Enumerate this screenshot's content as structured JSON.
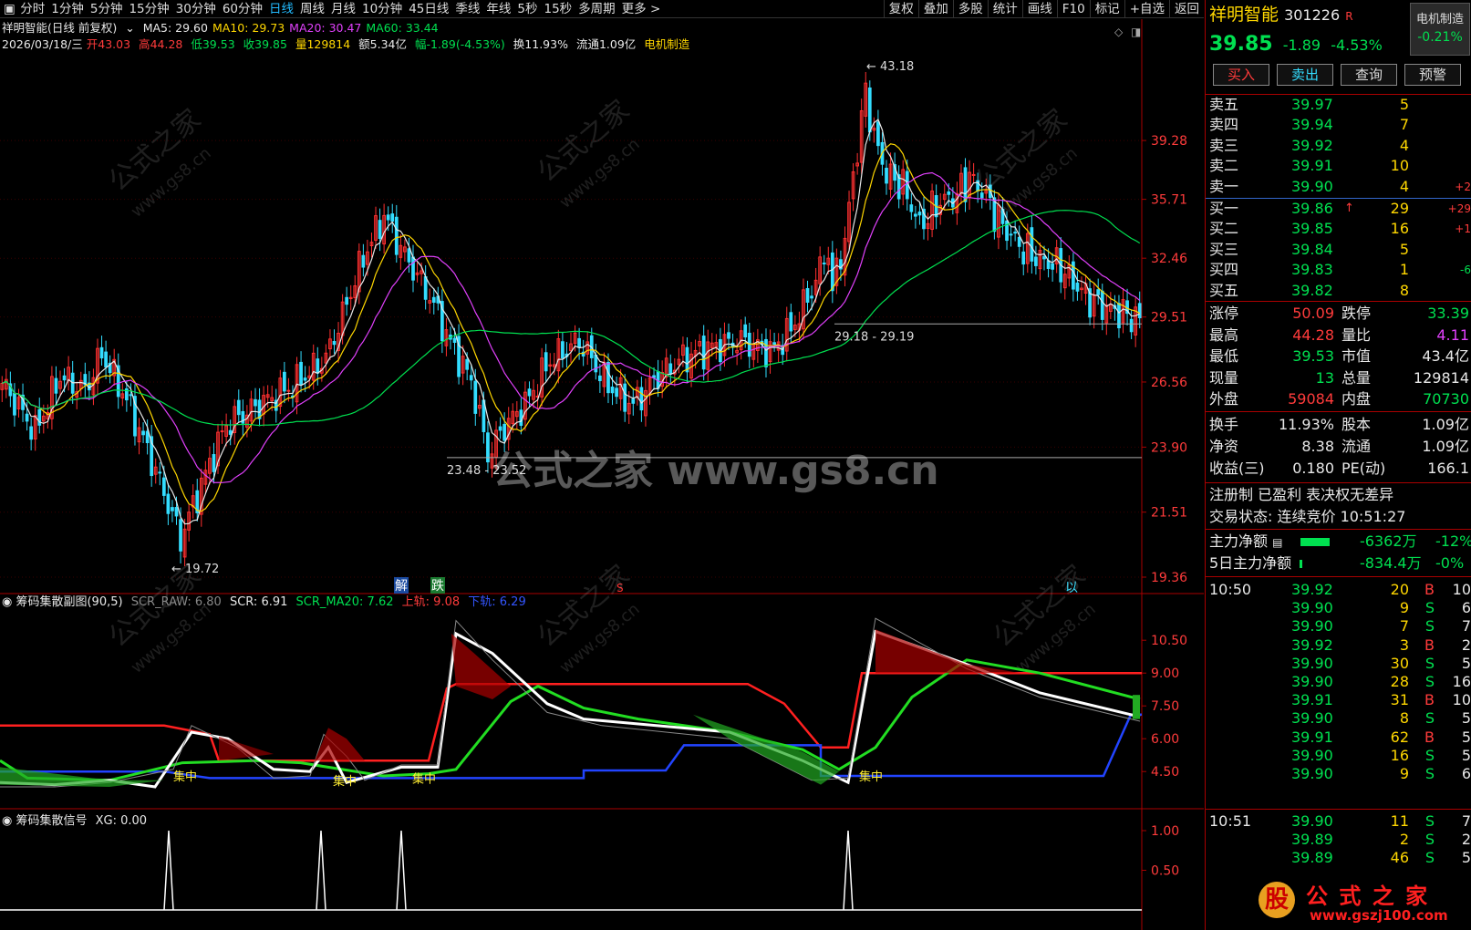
{
  "toolbar": {
    "periods": [
      "分时",
      "1分钟",
      "5分钟",
      "15分钟",
      "30分钟",
      "60分钟",
      "日线",
      "周线",
      "月线",
      "10分钟",
      "45日线",
      "季线",
      "年线",
      "5秒",
      "15秒",
      "多周期",
      "更多 >"
    ],
    "active_period": "日线",
    "tools": [
      "复权",
      "叠加",
      "多股",
      "统计",
      "画线",
      "F10",
      "标记",
      "+自选",
      "返回"
    ]
  },
  "main_chart": {
    "title": "祥明智能(日线 前复权)",
    "ma": [
      {
        "label": "MA5: 29.60",
        "color": "#e8e8e8"
      },
      {
        "label": "MA10: 29.73",
        "color": "#ffd700"
      },
      {
        "label": "MA20: 30.47",
        "color": "#e040fb"
      },
      {
        "label": "MA60: 33.44",
        "color": "#00e050"
      }
    ],
    "date": "2026/03/18/三",
    "open_label": "开",
    "open": "43.03",
    "high_label": "高",
    "high": "44.28",
    "low_label": "低",
    "low": "39.53",
    "close_label": "收",
    "close": "39.85",
    "vol_label": "量",
    "vol": "129814",
    "amount": "额5.34亿",
    "change": "幅-1.89(-4.53%)",
    "turnover": "换11.93%",
    "float": "流通1.09亿",
    "industry": "电机制造",
    "markers": {
      "jie": "解",
      "die": "跌",
      "s": "S",
      "ju": "以"
    },
    "annotations": {
      "peak": "43.18",
      "low_left": "19.72",
      "range1": "23.48 - 23.52",
      "range2": "29.18 - 29.19"
    },
    "watermark": "公式之家 www.gs8.cn",
    "watermark_small": "公式之家",
    "watermark_url": "www.gs8.cn"
  },
  "sub1": {
    "title": "筹码集散副图(90,5)",
    "scr_raw": "SCR_RAW: 6.80",
    "scr": "SCR: 6.91",
    "scr_ma20": "SCR_MA20: 7.62",
    "upper": "上轨: 9.08",
    "lower": "下轨: 6.29",
    "tag": "集中"
  },
  "sub2": {
    "title": "筹码集散信号",
    "xg": "XG: 0.00"
  },
  "price_axis": [
    "39.28",
    "35.71",
    "32.46",
    "29.51",
    "26.56",
    "23.90",
    "21.51",
    "19.36"
  ],
  "sub1_axis": [
    "10.50",
    "9.00",
    "7.50",
    "6.00",
    "4.50"
  ],
  "sub2_axis": [
    "1.00",
    "0.50"
  ],
  "chart_data": {
    "type": "candlestick",
    "y_range": [
      19.36,
      44.28
    ],
    "ma_series": [
      "MA5",
      "MA10",
      "MA20",
      "MA60"
    ]
  },
  "quote": {
    "name": "祥明智能",
    "code": "301226",
    "flag": "R",
    "industry_btn": "电机制造",
    "industry_change": "-0.21%",
    "price": "39.85",
    "change": "-1.89",
    "pct": "-4.53%",
    "buttons": [
      "买入",
      "卖出",
      "查询",
      "预警"
    ],
    "asks": [
      {
        "label": "卖五",
        "price": "39.97",
        "vol": "5",
        "extra": ""
      },
      {
        "label": "卖四",
        "price": "39.94",
        "vol": "7",
        "extra": ""
      },
      {
        "label": "卖三",
        "price": "39.92",
        "vol": "4",
        "extra": ""
      },
      {
        "label": "卖二",
        "price": "39.91",
        "vol": "10",
        "extra": ""
      },
      {
        "label": "卖一",
        "price": "39.90",
        "vol": "4",
        "extra": "+2"
      }
    ],
    "bids": [
      {
        "label": "买一",
        "price": "39.86",
        "vol": "29",
        "extra": "+29"
      },
      {
        "label": "买二",
        "price": "39.85",
        "vol": "16",
        "extra": "+1"
      },
      {
        "label": "买三",
        "price": "39.84",
        "vol": "5",
        "extra": ""
      },
      {
        "label": "买四",
        "price": "39.83",
        "vol": "1",
        "extra": "-6"
      },
      {
        "label": "买五",
        "price": "39.82",
        "vol": "8",
        "extra": ""
      }
    ],
    "stats": [
      {
        "l1": "涨停",
        "v1": "50.09",
        "c1": "red",
        "l2": "跌停",
        "v2": "33.39",
        "c2": "green"
      },
      {
        "l1": "最高",
        "v1": "44.28",
        "c1": "red",
        "l2": "量比",
        "v2": "4.11",
        "c2": "magenta"
      },
      {
        "l1": "最低",
        "v1": "39.53",
        "c1": "green",
        "l2": "市值",
        "v2": "43.4亿",
        "c2": "white"
      },
      {
        "l1": "现量",
        "v1": "13",
        "c1": "green",
        "l2": "总量",
        "v2": "129814",
        "c2": "white"
      },
      {
        "l1": "外盘",
        "v1": "59084",
        "c1": "red",
        "l2": "内盘",
        "v2": "70730",
        "c2": "green"
      }
    ],
    "stats2": [
      {
        "l1": "换手",
        "v1": "11.93%",
        "l2": "股本",
        "v2": "1.09亿"
      },
      {
        "l1": "净资",
        "v1": "8.38",
        "l2": "流通",
        "v2": "1.09亿"
      },
      {
        "l1": "收益(三)",
        "v1": "0.180",
        "l2": "PE(动)",
        "v2": "166.1"
      }
    ],
    "reg": "注册制 已盈利 表决权无差异",
    "state": "交易状态: 连续竞价 10:51:27",
    "main_flow_label": "主力净额",
    "main_flow": "-6362万",
    "main_flow_pct": "-12%",
    "flow5_label": "5日主力净额",
    "flow5": "-834.4万",
    "flow5_pct": "-0%",
    "ticks1_time": "10:50",
    "ticks1": [
      {
        "p": "39.92",
        "v": "20",
        "s": "B",
        "x": "10"
      },
      {
        "p": "39.90",
        "v": "9",
        "s": "S",
        "x": "6"
      },
      {
        "p": "39.90",
        "v": "7",
        "s": "S",
        "x": "7"
      },
      {
        "p": "39.92",
        "v": "3",
        "s": "B",
        "x": "2"
      },
      {
        "p": "39.90",
        "v": "30",
        "s": "S",
        "x": "5"
      },
      {
        "p": "39.90",
        "v": "28",
        "s": "S",
        "x": "16"
      },
      {
        "p": "39.91",
        "v": "31",
        "s": "B",
        "x": "10"
      },
      {
        "p": "39.90",
        "v": "8",
        "s": "S",
        "x": "5"
      },
      {
        "p": "39.91",
        "v": "62",
        "s": "B",
        "x": "5"
      },
      {
        "p": "39.90",
        "v": "16",
        "s": "S",
        "x": "5"
      },
      {
        "p": "39.90",
        "v": "9",
        "s": "S",
        "x": "6"
      }
    ],
    "ticks2_time": "10:51",
    "ticks2": [
      {
        "p": "39.90",
        "v": "11",
        "s": "S",
        "x": "7"
      },
      {
        "p": "39.89",
        "v": "2",
        "s": "S",
        "x": "2"
      },
      {
        "p": "39.89",
        "v": "46",
        "s": "S",
        "x": "5"
      }
    ],
    "logo_text": "公 式 之 家",
    "logo_url": "www.gszj100.com",
    "logo_gu": "股"
  }
}
